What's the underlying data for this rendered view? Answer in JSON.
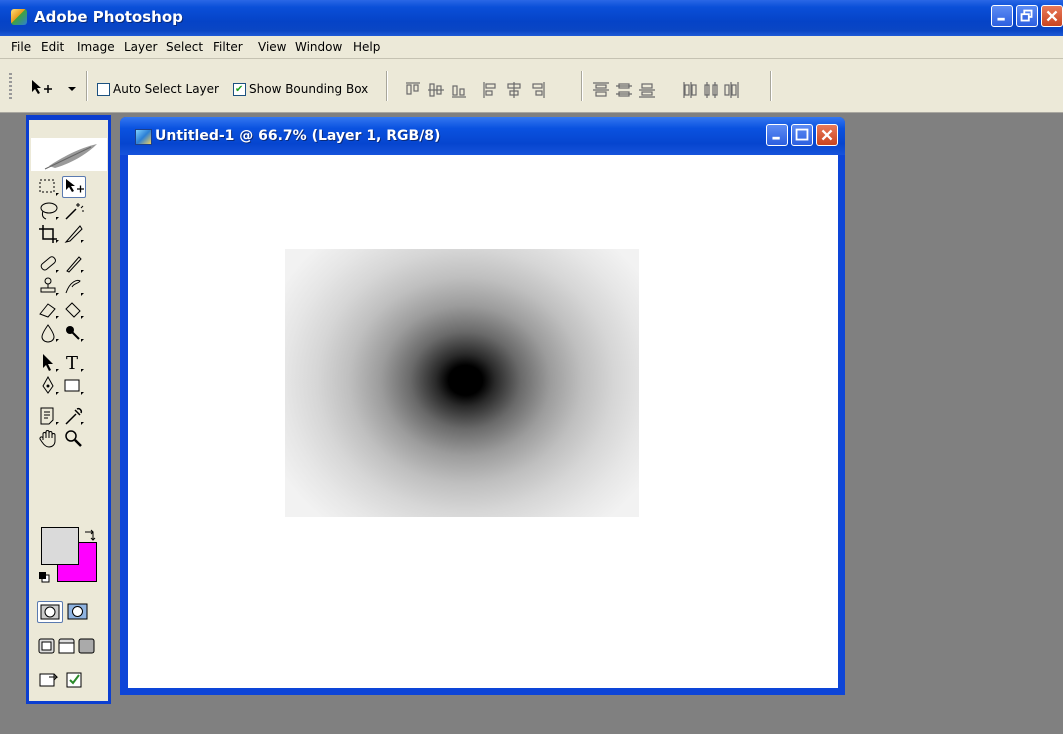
{
  "app": {
    "title": "Adobe Photoshop",
    "window_buttons": [
      "minimize-icon",
      "restore-icon",
      "close-icon"
    ]
  },
  "menubar": {
    "items": [
      "File",
      "Edit",
      "Image",
      "Layer",
      "Select",
      "Filter",
      "View",
      "Window",
      "Help"
    ]
  },
  "options_bar": {
    "tool_icon": "move-tool-icon",
    "auto_select_layer": {
      "label": "Auto Select Layer",
      "checked": false
    },
    "show_bounding_box": {
      "label": "Show Bounding Box",
      "checked": true
    },
    "align_icons": [
      "align-top-icon",
      "align-vertical-center-icon",
      "align-bottom-icon",
      "align-left-icon",
      "align-horizontal-center-icon",
      "align-right-icon"
    ],
    "distribute_icons": [
      "distribute-top-icon",
      "distribute-vertical-center-icon",
      "distribute-bottom-icon",
      "distribute-left-icon",
      "distribute-horizontal-center-icon",
      "distribute-right-icon"
    ]
  },
  "toolbox": {
    "tools": [
      "marquee-tool-icon",
      "move-tool-icon",
      "lasso-tool-icon",
      "magic-wand-icon",
      "crop-tool-icon",
      "slice-tool-icon",
      "healing-brush-icon",
      "brush-tool-icon",
      "clone-stamp-icon",
      "history-brush-icon",
      "eraser-tool-icon",
      "paint-bucket-icon",
      "blur-tool-icon",
      "burn-tool-icon",
      "path-selection-icon",
      "type-tool-icon",
      "pen-tool-icon",
      "rectangle-tool-icon",
      "notes-tool-icon",
      "eyedropper-icon",
      "hand-tool-icon",
      "zoom-tool-icon"
    ],
    "foreground_color": "#dadada",
    "background_color": "#ff00ff"
  },
  "document": {
    "title": "Untitled-1 @ 66.7% (Layer 1, RGB/8)",
    "zoom": "66.7%",
    "layer": "Layer 1",
    "mode": "RGB/8"
  },
  "colors": {
    "titlebar_blue": "#0543c7",
    "menu_bg": "#ece9d8",
    "workspace_gray": "#808080"
  }
}
